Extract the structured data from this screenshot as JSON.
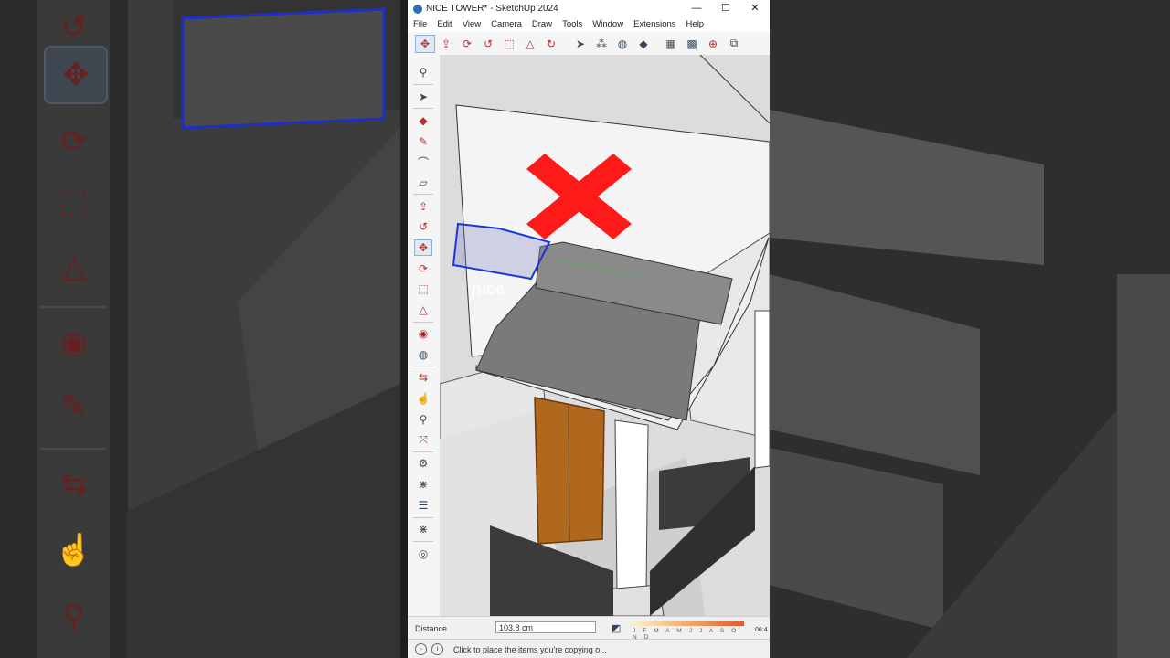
{
  "window": {
    "title": "NICE TOWER* - SketchUp 2024",
    "controls": {
      "minimize": "—",
      "maximize": "☐",
      "close": "✕"
    }
  },
  "menu": [
    "File",
    "Edit",
    "View",
    "Camera",
    "Draw",
    "Tools",
    "Window",
    "Extensions",
    "Help"
  ],
  "icons": {
    "top_toolbar": [
      "move-icon",
      "push-pull-icon",
      "rotate-icon",
      "follow-me-icon",
      "scale-icon",
      "offset-icon",
      "paint-icon",
      "select-icon",
      "component-icon",
      "paint-bucket-icon",
      "eraser-icon",
      "section-plane-icon",
      "tag-icon",
      "axes-icon",
      "dimension-icon"
    ],
    "left_toolbar": [
      "zoom-icon",
      "select-icon",
      "eraser-icon",
      "pencil-icon",
      "arc-icon",
      "rectangle-icon",
      "push-pull-icon",
      "follow-me-icon",
      "move-icon",
      "rotate-icon",
      "scale-icon",
      "offset-icon",
      "tape-measure-icon",
      "paint-bucket-icon",
      "orbit-icon",
      "pan-icon",
      "zoom-icon",
      "zoom-extents-icon",
      "warehouse-icon",
      "extension-icon",
      "layers-icon",
      "extension-icon",
      "profile-icon"
    ]
  },
  "watermark": "nice",
  "vcb": {
    "label": "Distance",
    "value": "103.8 cm"
  },
  "shadow": {
    "months": "J F M A M J J A S O N D",
    "time": "06:4"
  },
  "status": {
    "message": "Click to place the items you're copying o..."
  },
  "colors": {
    "selection_blue": "#1a35d8",
    "cancel_red": "#ff1a1a",
    "door_wood": "#b0681f"
  }
}
